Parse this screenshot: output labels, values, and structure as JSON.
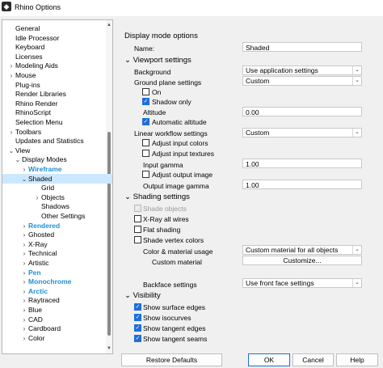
{
  "window": {
    "title": "Rhino Options"
  },
  "tree": {
    "items": [
      {
        "label": "General",
        "indent": 0,
        "chev": ""
      },
      {
        "label": "Idle Processor",
        "indent": 0,
        "chev": ""
      },
      {
        "label": "Keyboard",
        "indent": 0,
        "chev": ""
      },
      {
        "label": "Licenses",
        "indent": 0,
        "chev": ""
      },
      {
        "label": "Modeling Aids",
        "indent": 0,
        "chev": ">"
      },
      {
        "label": "Mouse",
        "indent": 0,
        "chev": ">"
      },
      {
        "label": "Plug-ins",
        "indent": 0,
        "chev": ""
      },
      {
        "label": "Render Libraries",
        "indent": 0,
        "chev": ""
      },
      {
        "label": "Rhino Render",
        "indent": 0,
        "chev": ""
      },
      {
        "label": "RhinoScript",
        "indent": 0,
        "chev": ""
      },
      {
        "label": "Selection Menu",
        "indent": 0,
        "chev": ""
      },
      {
        "label": "Toolbars",
        "indent": 0,
        "chev": ">"
      },
      {
        "label": "Updates and Statistics",
        "indent": 0,
        "chev": ""
      },
      {
        "label": "View",
        "indent": 0,
        "chev": "v"
      },
      {
        "label": "Display Modes",
        "indent": 1,
        "chev": "v"
      },
      {
        "label": "Wireframe",
        "indent": 2,
        "chev": ">",
        "style": "blue"
      },
      {
        "label": "Shaded",
        "indent": 2,
        "chev": "v",
        "selected": true
      },
      {
        "label": "Grid",
        "indent": 3,
        "chev": ""
      },
      {
        "label": "Objects",
        "indent": 3,
        "chev": ">"
      },
      {
        "label": "Shadows",
        "indent": 3,
        "chev": ""
      },
      {
        "label": "Other Settings",
        "indent": 3,
        "chev": ""
      },
      {
        "label": "Rendered",
        "indent": 2,
        "chev": ">",
        "style": "blue"
      },
      {
        "label": "Ghosted",
        "indent": 2,
        "chev": ">"
      },
      {
        "label": "X-Ray",
        "indent": 2,
        "chev": ">"
      },
      {
        "label": "Technical",
        "indent": 2,
        "chev": ">"
      },
      {
        "label": "Artistic",
        "indent": 2,
        "chev": ">"
      },
      {
        "label": "Pen",
        "indent": 2,
        "chev": ">",
        "style": "blue"
      },
      {
        "label": "Monochrome",
        "indent": 2,
        "chev": ">",
        "style": "blue"
      },
      {
        "label": "Arctic",
        "indent": 2,
        "chev": ">",
        "style": "blue"
      },
      {
        "label": "Raytraced",
        "indent": 2,
        "chev": ">"
      },
      {
        "label": "Blue",
        "indent": 2,
        "chev": ">"
      },
      {
        "label": "CAD",
        "indent": 2,
        "chev": ">"
      },
      {
        "label": "Cardboard",
        "indent": 2,
        "chev": ">"
      },
      {
        "label": "Color",
        "indent": 2,
        "chev": ">"
      }
    ]
  },
  "display_mode": {
    "heading": "Display mode options",
    "name_label": "Name:",
    "name_value": "Shaded"
  },
  "viewport": {
    "heading": "Viewport settings",
    "background_label": "Background",
    "background_value": "Use application settings",
    "ground_label": "Ground plane settings",
    "ground_value": "Custom",
    "on_label": "On",
    "shadow_only_label": "Shadow only",
    "altitude_label": "Altitude",
    "altitude_value": "0.00",
    "auto_altitude_label": "Automatic altitude",
    "linear_label": "Linear workflow settings",
    "linear_value": "Custom",
    "adjust_input_colors_label": "Adjust input colors",
    "adjust_input_textures_label": "Adjust input textures",
    "input_gamma_label": "Input gamma",
    "input_gamma_value": "1.00",
    "adjust_output_image_label": "Adjust output image",
    "output_gamma_label": "Output image gamma",
    "output_gamma_value": "1.00"
  },
  "shading": {
    "heading": "Shading settings",
    "shade_objects_label": "Shade objects",
    "xray_label": "X-Ray all wires",
    "flat_label": "Flat shading",
    "shade_vertex_label": "Shade vertex colors",
    "color_material_label": "Color & material usage",
    "color_material_value": "Custom material for all objects",
    "custom_material_label": "Custom material",
    "customize_button": "Customize...",
    "backface_label": "Backface settings",
    "backface_value": "Use front face settings"
  },
  "visibility": {
    "heading": "Visibility",
    "surface_edges_label": "Show surface edges",
    "isocurves_label": "Show isocurves",
    "tangent_edges_label": "Show tangent edges",
    "tangent_seams_label": "Show tangent seams"
  },
  "buttons": {
    "restore": "Restore Defaults",
    "ok": "OK",
    "cancel": "Cancel",
    "help": "Help"
  },
  "colors": {
    "accent": "#1e6fd9",
    "selection": "#cce8ff",
    "highlight_text": "#1e90d6"
  }
}
